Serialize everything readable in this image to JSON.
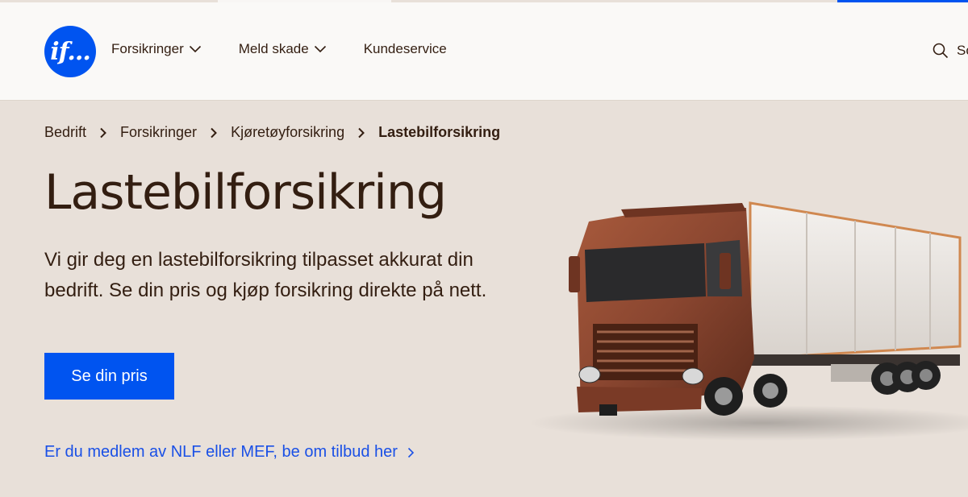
{
  "header": {
    "logo_text": "if...",
    "nav": [
      {
        "label": "Forsikringer",
        "has_dropdown": true
      },
      {
        "label": "Meld skade",
        "has_dropdown": true
      },
      {
        "label": "Kundeservice",
        "has_dropdown": false
      }
    ],
    "search_label": "So"
  },
  "breadcrumb": {
    "items": [
      "Bedrift",
      "Forsikringer",
      "Kjøretøyforsikring"
    ],
    "current": "Lastebilforsikring"
  },
  "hero": {
    "title": "Lastebilforsikring",
    "lead": "Vi gir deg en lastebilforsikring tilpasset akkurat din bedrift. Se din pris og kjøp forsikring direkte på nett.",
    "cta_label": "Se din pris",
    "member_link": "Er du medlem av NLF eller MEF, be om tilbud her"
  },
  "colors": {
    "brand_blue": "#0054f0",
    "background": "#e8e0d9",
    "header_bg": "#faf9f7",
    "text": "#331e11",
    "truck_cab": "#8a4630"
  },
  "icons": {
    "logo": "if-logo",
    "nav_dropdown": "chevron-down-icon",
    "search": "search-icon",
    "breadcrumb_separator": "chevron-right-icon",
    "link_arrow": "chevron-right-icon"
  }
}
